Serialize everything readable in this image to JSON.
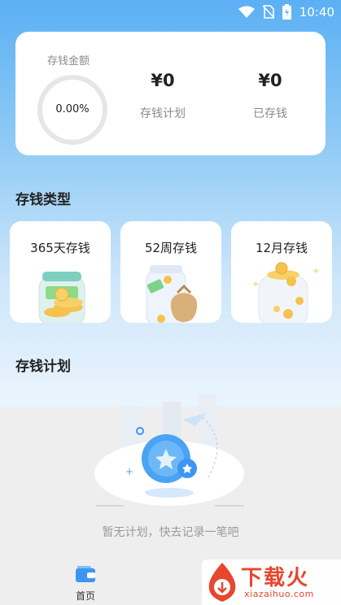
{
  "status_bar": {
    "time": "10:40",
    "icons": [
      "wifi-icon",
      "no-sim-icon",
      "battery-charging-icon"
    ]
  },
  "summary": {
    "label": "存钱金额",
    "progress_text": "0.00%",
    "progress": 0,
    "plan": {
      "value": "¥0",
      "label": "存钱计划"
    },
    "saved": {
      "value": "¥0",
      "label": "已存钱"
    }
  },
  "types_section": {
    "title": "存钱类型",
    "items": [
      {
        "label": "365天存钱",
        "icon": "money-jar-icon"
      },
      {
        "label": "52周存钱",
        "icon": "money-bag-icon"
      },
      {
        "label": "12月存钱",
        "icon": "coin-jar-icon"
      }
    ]
  },
  "plan_section": {
    "title": "存钱计划",
    "empty_text": "暂无计划，快去记录一笔吧"
  },
  "bottom_nav": {
    "home_label": "首页",
    "home_icon": "wallet-icon"
  },
  "watermark": {
    "title": "下载火",
    "subtitle": "xiazaihuo.com"
  },
  "colors": {
    "accent": "#3d95f2",
    "gradient_top": "#5bb0f3",
    "text": "#222222",
    "muted": "#8a8a8a"
  }
}
